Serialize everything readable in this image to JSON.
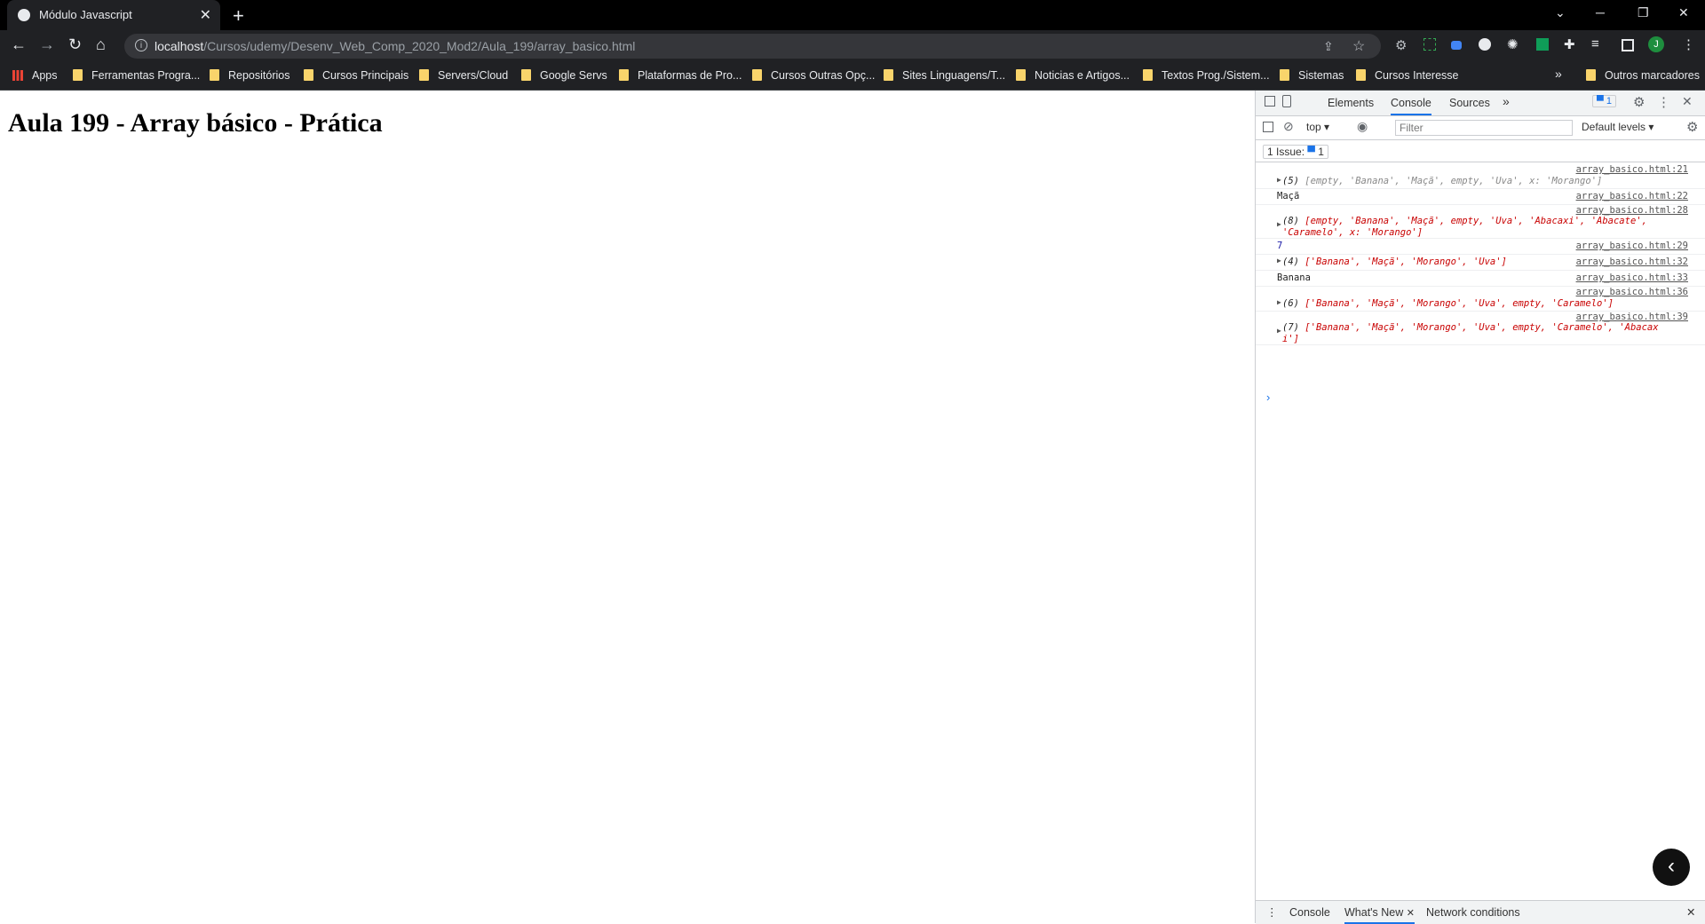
{
  "tab": {
    "title": "Módulo Javascript",
    "close": "✕",
    "new_tab": "+"
  },
  "window": {
    "minimize": "─",
    "restore": "❐",
    "close": "✕",
    "tabsearch": "⌄"
  },
  "nav": {
    "back": "←",
    "forward": "→",
    "reload": "↻",
    "home": "⌂"
  },
  "address": {
    "host": "localhost",
    "path": "/Cursos/udemy/Desenv_Web_Comp_2020_Mod2/Aula_199/array_basico.html"
  },
  "bookmarks": {
    "apps": "Apps",
    "items": [
      "Ferramentas Progra...",
      "Repositórios",
      "Cursos Principais",
      "Servers/Cloud",
      "Google Servs",
      "Plataformas de Pro...",
      "Cursos Outras Opç...",
      "Sites Linguagens/T...",
      "Noticias e Artigos...",
      "Textos Prog./Sistem...",
      "Sistemas",
      "Cursos Interesse"
    ],
    "overflow": "»",
    "other": "Outros marcadores"
  },
  "page": {
    "heading": "Aula 199 - Array básico - Prática"
  },
  "devtools": {
    "tabs": [
      "Elements",
      "Console",
      "Sources"
    ],
    "more_tabs": "»",
    "issue_badge": "1",
    "context": "top",
    "filter_placeholder": "Filter",
    "levels": "Default levels",
    "issues_text": "1 Issue:",
    "issues_count": "1",
    "logs": [
      {
        "src": "array_basico.html:21",
        "count": "(5)",
        "msg": "[empty, 'Banana', 'Maçã', empty, 'Uva', x: 'Morango']"
      },
      {
        "src": "array_basico.html:22",
        "msg": "Maçã"
      },
      {
        "src": "array_basico.html:28",
        "count": "(8)",
        "msg": "[empty, 'Banana', 'Maçã', empty, 'Uva', 'Abacaxi', 'Abacate',",
        "msg2": "'Caramelo', x: 'Morango']"
      },
      {
        "src": "array_basico.html:29",
        "msg": "7"
      },
      {
        "src": "array_basico.html:32",
        "count": "(4)",
        "msg": "['Banana', 'Maçã', 'Morango', 'Uva']"
      },
      {
        "src": "array_basico.html:33",
        "msg": "Banana"
      },
      {
        "src": "array_basico.html:36",
        "count": "(6)",
        "msg": "['Banana', 'Maçã', 'Morango', 'Uva', empty, 'Caramelo']"
      },
      {
        "src": "array_basico.html:39",
        "count": "(7)",
        "msg": "['Banana', 'Maçã', 'Morango', 'Uva', empty, 'Caramelo', 'Abacax",
        "msg2": "i']"
      }
    ],
    "prompt": "›",
    "drawer_tabs": [
      "Console",
      "What's New",
      "Network conditions"
    ],
    "drawer_close": "✕"
  },
  "colors": {
    "accent": "#1a73e8",
    "string": "#c80000",
    "folder": "#f9d46b"
  }
}
